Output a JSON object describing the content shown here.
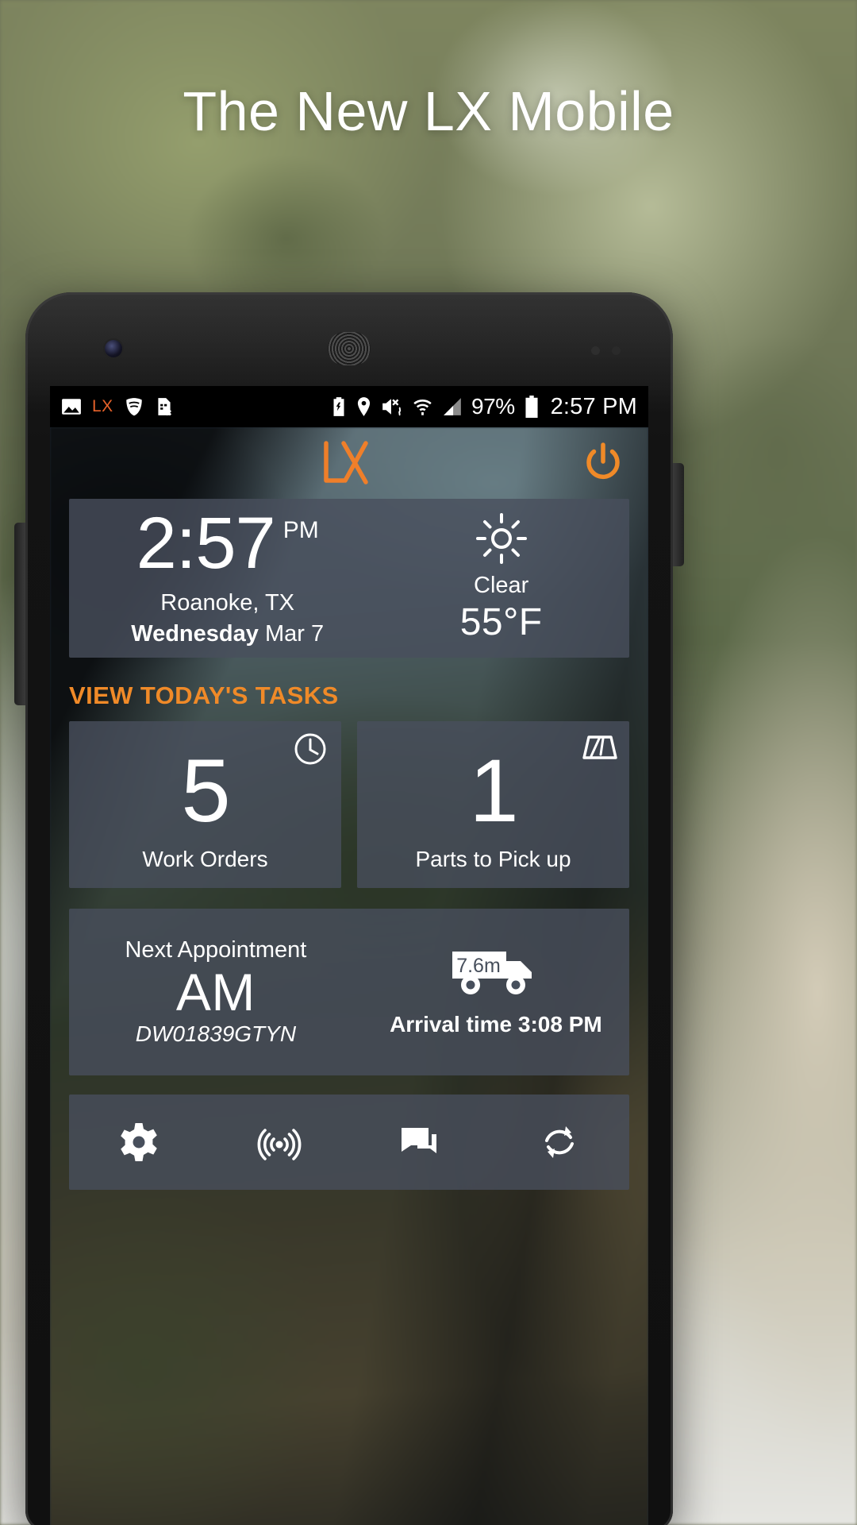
{
  "hero": {
    "title": "The New LX Mobile"
  },
  "statusbar": {
    "left_icons": [
      "image-icon",
      "lx-notification-icon",
      "vpn-shield-icon",
      "sim-card-error-icon"
    ],
    "lx_label": "LX",
    "right_icons": [
      "battery-saver-icon",
      "location-pin-icon",
      "vibrate-mute-icon",
      "wifi-icon",
      "cell-signal-icon"
    ],
    "battery_percent": "97%",
    "clock": "2:57 PM"
  },
  "app": {
    "logo_label": "LX",
    "power_button": "power-icon",
    "clock_card": {
      "time": "2:57",
      "ampm": "PM",
      "city": "Roanoke, TX",
      "day": "Wednesday",
      "date": "Mar 7",
      "weather_icon": "sun-clear-icon",
      "condition": "Clear",
      "temperature": "55°F"
    },
    "tasks_link": "VIEW TODAY'S TASKS",
    "stats": [
      {
        "value": "5",
        "label": "Work Orders",
        "icon": "clock-icon"
      },
      {
        "value": "1",
        "label": "Parts to Pick up",
        "icon": "windshield-wiper-icon"
      }
    ],
    "appointment": {
      "label": "Next Appointment",
      "period": "AM",
      "id": "DW01839GTYN",
      "distance": "7.6m",
      "vehicle_icon": "delivery-truck-icon",
      "arrival": "Arrival time 3:08 PM"
    },
    "nav": [
      {
        "icon": "gear-icon",
        "name": "settings"
      },
      {
        "icon": "broadcast-icon",
        "name": "locate"
      },
      {
        "icon": "chat-icon",
        "name": "messages"
      },
      {
        "icon": "refresh-icon",
        "name": "sync"
      }
    ]
  },
  "colors": {
    "accent_orange": "#f08a28",
    "logo_orange": "#ef7f2a",
    "card_bg": "rgba(72,79,92,.80)"
  }
}
